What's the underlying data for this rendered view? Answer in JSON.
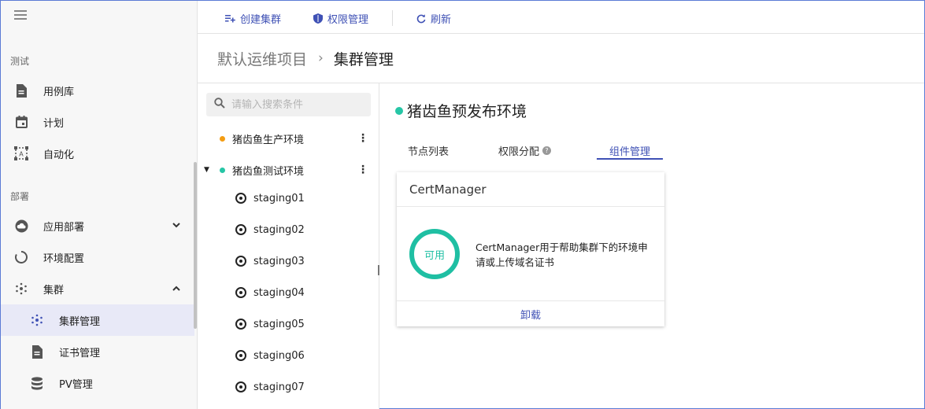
{
  "colors": {
    "accent": "#3f51b5",
    "green": "#26c6a6",
    "orange": "#f39c12",
    "teal": "#1fbfa3"
  },
  "sidebar": {
    "menu_icon": "menu-icon",
    "sections": [
      {
        "label": "测试"
      },
      {
        "label": "部署"
      }
    ],
    "items": [
      {
        "label": "用例库",
        "icon": "document-icon"
      },
      {
        "label": "计划",
        "icon": "calendar-icon"
      },
      {
        "label": "自动化",
        "icon": "automation-icon"
      },
      {
        "label": "应用部署",
        "icon": "cloud-icon"
      },
      {
        "label": "环境配置",
        "icon": "loading-ring-icon"
      },
      {
        "label": "集群",
        "icon": "cluster-icon"
      },
      {
        "label": "集群管理",
        "icon": "cluster-icon"
      },
      {
        "label": "证书管理",
        "icon": "certificate-icon"
      },
      {
        "label": "PV管理",
        "icon": "database-icon"
      }
    ]
  },
  "toolbar": {
    "create_cluster": "创建集群",
    "permissions": "权限管理",
    "refresh": "刷新"
  },
  "breadcrumb": {
    "project": "默认运维项目",
    "separator": "›",
    "page": "集群管理"
  },
  "search": {
    "placeholder": "请输入搜索条件"
  },
  "environments": [
    {
      "name": "猪齿鱼生产环境",
      "status_color": "#f39c12"
    },
    {
      "name": "猪齿鱼测试环境",
      "status_color": "#26c6a6"
    }
  ],
  "nodes": [
    "staging01",
    "staging02",
    "staging03",
    "staging04",
    "staging05",
    "staging06",
    "staging07"
  ],
  "detail": {
    "title": "猪齿鱼预发布环境",
    "tabs": [
      "节点列表",
      "权限分配",
      "组件管理"
    ],
    "active_tab": "组件管理",
    "component": {
      "name": "CertManager",
      "status": "可用",
      "description": "CertManager用于帮助集群下的环境申请或上传域名证书",
      "action": "卸载"
    }
  }
}
